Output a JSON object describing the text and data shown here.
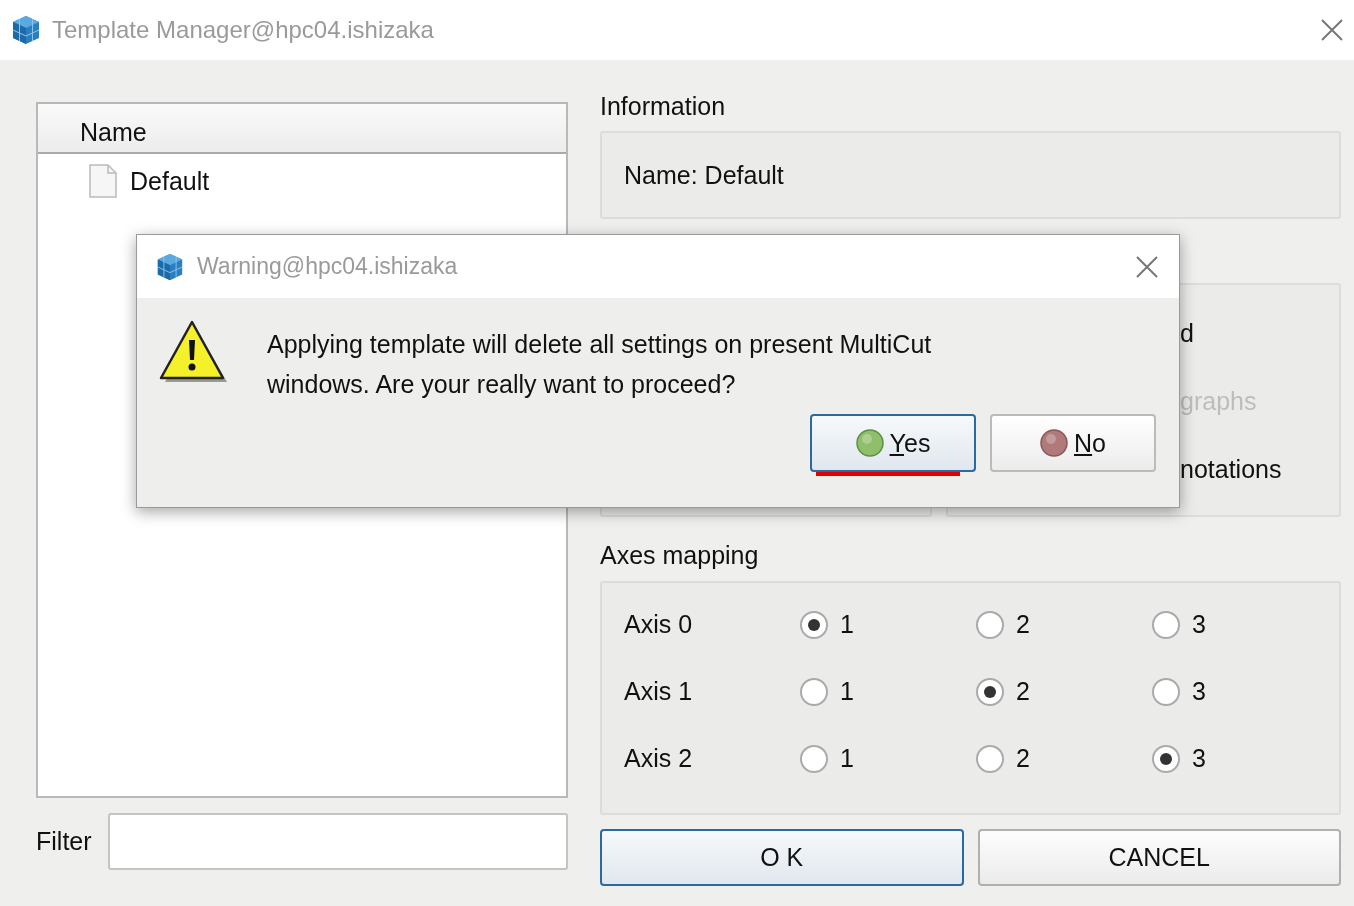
{
  "window": {
    "title": "Template Manager@hpc04.ishizaka"
  },
  "template_list": {
    "header": "Name",
    "items": [
      {
        "label": "Default",
        "selected": false
      }
    ]
  },
  "filter": {
    "label": "Filter"
  },
  "information": {
    "title": "Information",
    "name_text": "Name: Default"
  },
  "options_group": {
    "items": [
      {
        "text": "d",
        "disabled": false
      },
      {
        "text": "graphs",
        "disabled": true
      },
      {
        "text": "notations",
        "disabled": false
      }
    ]
  },
  "axes_mapping": {
    "title": "Axes mapping",
    "rows": [
      {
        "label": "Axis 0",
        "options": [
          {
            "label": "1",
            "selected": true
          },
          {
            "label": "2",
            "selected": false
          },
          {
            "label": "3",
            "selected": false
          }
        ]
      },
      {
        "label": "Axis 1",
        "options": [
          {
            "label": "1",
            "selected": false
          },
          {
            "label": "2",
            "selected": true
          },
          {
            "label": "3",
            "selected": false
          }
        ]
      },
      {
        "label": "Axis 2",
        "options": [
          {
            "label": "1",
            "selected": false
          },
          {
            "label": "2",
            "selected": false
          },
          {
            "label": "3",
            "selected": true
          }
        ]
      }
    ]
  },
  "buttons": [
    {
      "label": "O K",
      "focused": true
    },
    {
      "label": "CANCEL",
      "focused": false
    }
  ],
  "dialog": {
    "title": "Warning@hpc04.ishizaka",
    "message": "Applying template will delete all settings on present MultiCut windows. Are your really want to proceed?",
    "buttons": [
      {
        "label": "Yes",
        "kind": "yes",
        "focused": true,
        "underlined": true
      },
      {
        "label": "No",
        "kind": "no",
        "focused": false,
        "underlined": false
      }
    ]
  }
}
